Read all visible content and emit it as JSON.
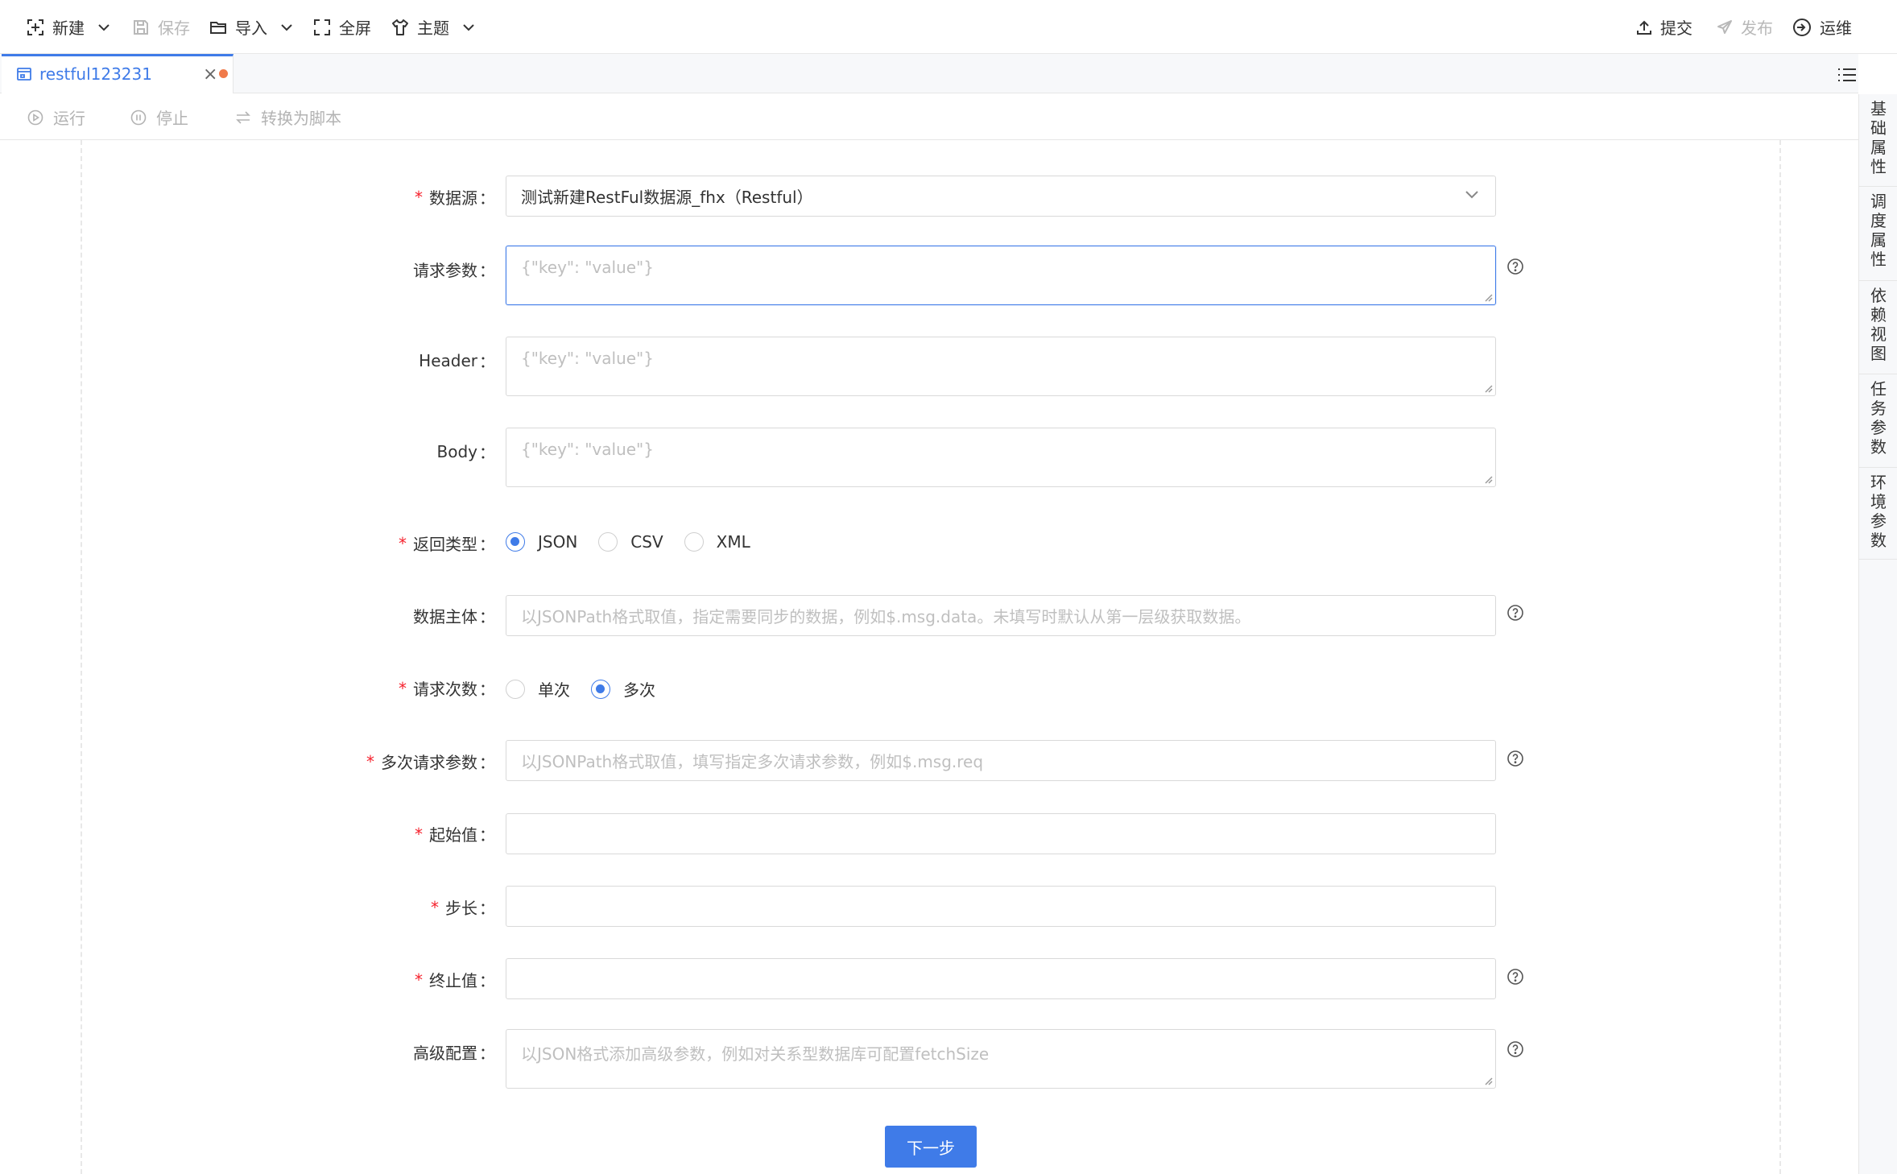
{
  "toolbar": {
    "new_label": "新建",
    "save_label": "保存",
    "import_label": "导入",
    "fullscreen_label": "全屏",
    "theme_label": "主题",
    "submit_label": "提交",
    "publish_label": "发布",
    "ops_label": "运维"
  },
  "tab": {
    "label": "restful123231",
    "close": "×"
  },
  "actions": {
    "run_label": "运行",
    "stop_label": "停止",
    "convert_label": "转换为脚本"
  },
  "side_panel": {
    "items": [
      "基础属性",
      "调度属性",
      "依赖视图",
      "任务参数",
      "环境参数"
    ]
  },
  "form": {
    "datasource": {
      "label": "数据源",
      "value": "测试新建RestFul数据源_fhx（Restful）"
    },
    "request_params": {
      "label": "请求参数",
      "placeholder": "{\"key\": \"value\"}"
    },
    "header": {
      "label": "Header",
      "placeholder": "{\"key\": \"value\"}"
    },
    "body": {
      "label": "Body",
      "placeholder": "{\"key\": \"value\"}"
    },
    "return_type": {
      "label": "返回类型",
      "options": [
        "JSON",
        "CSV",
        "XML"
      ],
      "selected": "JSON"
    },
    "data_subject": {
      "label": "数据主体",
      "placeholder": "以JSONPath格式取值，指定需要同步的数据，例如$.msg.data。未填写时默认从第一层级获取数据。"
    },
    "request_count": {
      "label": "请求次数",
      "options": [
        "单次",
        "多次"
      ],
      "selected": "多次"
    },
    "multi_params": {
      "label": "多次请求参数",
      "placeholder": "以JSONPath格式取值，填写指定多次请求参数，例如$.msg.req"
    },
    "start_value": {
      "label": "起始值",
      "value": ""
    },
    "step": {
      "label": "步长",
      "value": ""
    },
    "end_value": {
      "label": "终止值",
      "value": ""
    },
    "advanced": {
      "label": "高级配置",
      "placeholder": "以JSON格式添加高级参数，例如对关系型数据库可配置fetchSize"
    },
    "colon": "：",
    "required_mark": "*"
  },
  "next_button": "下一步",
  "colors": {
    "accent": "#3f7be8",
    "required": "#f5222d",
    "unsaved_dot": "#f07a4a"
  }
}
